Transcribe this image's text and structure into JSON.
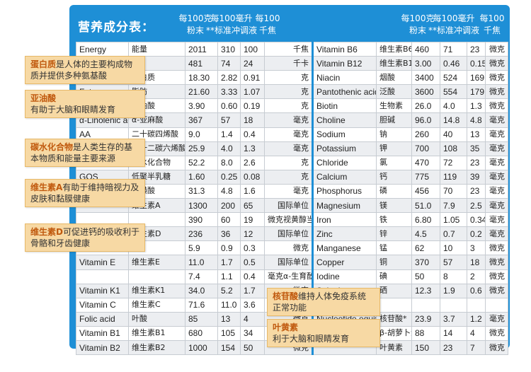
{
  "header": {
    "title": "营养成分表：",
    "left_cols": [
      {
        "line1": "每100克",
        "line2": "粉末"
      },
      {
        "line1": "每100毫升",
        "line2": "**标准冲调液"
      },
      {
        "line1": "每100",
        "line2": "千焦"
      }
    ],
    "right_cols": [
      {
        "line1": "每100克",
        "line2": "粉末"
      },
      {
        "line1": "每100毫升",
        "line2": "**标准冲调液"
      },
      {
        "line1": "每100",
        "line2": "千焦"
      }
    ]
  },
  "rows": [
    {
      "l": [
        "Energy",
        "能量",
        "2011",
        "310",
        "100",
        "千焦"
      ],
      "r": [
        "Vitamin B6",
        "维生素B6",
        "460",
        "71",
        "23",
        "微克"
      ]
    },
    {
      "l": [
        "",
        "",
        "481",
        "74",
        "24",
        "千卡"
      ],
      "r": [
        "Vitamin B12",
        "维生素B12",
        "3.00",
        "0.46",
        "0.15",
        "微克"
      ]
    },
    {
      "l": [
        "",
        "蛋白质",
        "18.30",
        "2.82",
        "0.91",
        "克"
      ],
      "r": [
        "Niacin",
        "烟酸",
        "3400",
        "524",
        "169",
        "微克"
      ]
    },
    {
      "l": [
        "Fat",
        "脂肪",
        "21.60",
        "3.33",
        "1.07",
        "克"
      ],
      "r": [
        "Pantothenic acid",
        "泛酸",
        "3600",
        "554",
        "179",
        "微克"
      ]
    },
    {
      "l": [
        "",
        "亚油酸",
        "3.90",
        "0.60",
        "0.19",
        "克"
      ],
      "r": [
        "Biotin",
        "生物素",
        "26.0",
        "4.0",
        "1.3",
        "微克"
      ]
    },
    {
      "l": [
        "α-Linolenic acid",
        "α-亚麻酸",
        "367",
        "57",
        "18",
        "毫克"
      ],
      "r": [
        "Choline",
        "胆碱",
        "96.0",
        "14.8",
        "4.8",
        "毫克"
      ]
    },
    {
      "l": [
        "AA",
        "二十碳四烯酸",
        "9.0",
        "1.4",
        "0.4",
        "毫克"
      ],
      "r": [
        "Sodium",
        "钠",
        "260",
        "40",
        "13",
        "毫克"
      ]
    },
    {
      "l": [
        "",
        "二十二碳六烯酸",
        "25.9",
        "4.0",
        "1.3",
        "毫克"
      ],
      "r": [
        "Potassium",
        "钾",
        "700",
        "108",
        "35",
        "毫克"
      ]
    },
    {
      "l": [
        "",
        "碳水化合物",
        "52.2",
        "8.0",
        "2.6",
        "克"
      ],
      "r": [
        "Chloride",
        "氯",
        "470",
        "72",
        "23",
        "毫克"
      ]
    },
    {
      "l": [
        "GOS",
        "低聚半乳糖",
        "1.60",
        "0.25",
        "0.08",
        "克"
      ],
      "r": [
        "Calcium",
        "钙",
        "775",
        "119",
        "39",
        "毫克"
      ]
    },
    {
      "l": [
        "",
        "牛磺酸",
        "31.3",
        "4.8",
        "1.6",
        "毫克"
      ],
      "r": [
        "Phosphorus",
        "磷",
        "456",
        "70",
        "23",
        "毫克"
      ]
    },
    {
      "l": [
        "",
        "维生素A",
        "1300",
        "200",
        "65",
        "国际单位"
      ],
      "r": [
        "Magnesium",
        "镁",
        "51.0",
        "7.9",
        "2.5",
        "毫克"
      ]
    },
    {
      "l": [
        "",
        "",
        "390",
        "60",
        "19",
        "微克视黄醇当量"
      ],
      "r": [
        "Iron",
        "铁",
        "6.80",
        "1.05",
        "0.34",
        "毫克"
      ]
    },
    {
      "l": [
        "",
        "维生素D",
        "236",
        "36",
        "12",
        "国际单位"
      ],
      "r": [
        "Zinc",
        "锌",
        "4.5",
        "0.7",
        "0.2",
        "毫克"
      ]
    },
    {
      "l": [
        "",
        "",
        "5.9",
        "0.9",
        "0.3",
        "微克"
      ],
      "r": [
        "Manganese",
        "锰",
        "62",
        "10",
        "3",
        "微克"
      ]
    },
    {
      "l": [
        "Vitamin E",
        "维生素E",
        "11.0",
        "1.7",
        "0.5",
        "国际单位"
      ],
      "r": [
        "Copper",
        "铜",
        "370",
        "57",
        "18",
        "微克"
      ]
    },
    {
      "l": [
        "",
        "",
        "7.4",
        "1.1",
        "0.4",
        "毫克α-生育酚当量"
      ],
      "r": [
        "Iodine",
        "碘",
        "50",
        "8",
        "2",
        "微克"
      ]
    },
    {
      "l": [
        "Vitamin K1",
        "维生素K1",
        "34.0",
        "5.2",
        "1.7",
        "微克"
      ],
      "r": [
        "Selenium",
        "硒",
        "12.3",
        "1.9",
        "0.6",
        "微克"
      ]
    },
    {
      "l": [
        "Vitamin C",
        "维生素C",
        "71.6",
        "11.0",
        "3.6",
        "毫克"
      ],
      "r": [
        "",
        "",
        "",
        "",
        "",
        ""
      ]
    },
    {
      "l": [
        "Folic acid",
        "叶酸",
        "85",
        "13",
        "4",
        "微克"
      ],
      "r": [
        "Nucleotide equivalents",
        "核苷酸*",
        "23.9",
        "3.7",
        "1.2",
        "毫克"
      ]
    },
    {
      "l": [
        "Vitamin B1",
        "维生素B1",
        "680",
        "105",
        "34",
        "微克"
      ],
      "r": [
        "Beta Carotene",
        "β-胡萝卜素",
        "88",
        "14",
        "4",
        "微克"
      ]
    },
    {
      "l": [
        "Vitamin B2",
        "维生素B2",
        "1000",
        "154",
        "50",
        "微克"
      ],
      "r": [
        "",
        "叶黄素",
        "150",
        "23",
        "7",
        "微克"
      ]
    }
  ],
  "callouts": [
    {
      "title": "蛋白质",
      "text": "是人体的主要构成物质并提供多种氨基酸"
    },
    {
      "title": "亚油酸",
      "text": "有助于大脑和眼睛发育"
    },
    {
      "title": "碳水化合物",
      "text": "是人类生存的基本物质和能量主要来源"
    },
    {
      "title": "维生素A",
      "text": "有助于维持暗视力及皮肤和黏膜健康"
    },
    {
      "title": "维生素D",
      "text": "可促进钙的吸收利于骨骼和牙齿健康"
    },
    {
      "title": "核苷酸",
      "text": "维持人体免疫系统正常功能"
    },
    {
      "title": "叶黄素",
      "text": "利于大脑和眼睛发育"
    }
  ],
  "colors": {
    "panel": "#1e8fd6",
    "callout_bg": "#f7d9a4",
    "callout_title": "#c0590e"
  }
}
